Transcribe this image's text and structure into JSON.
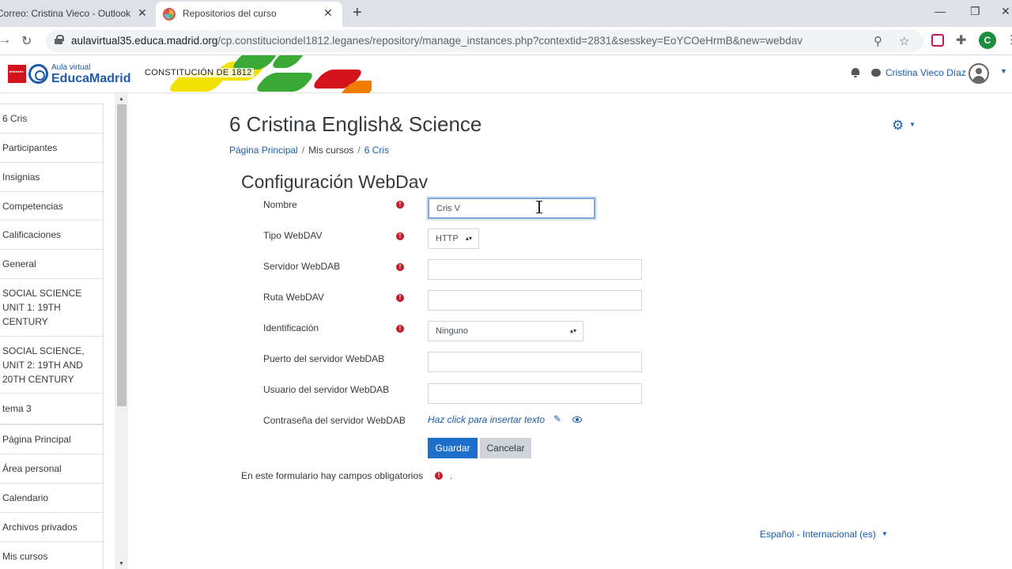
{
  "browser": {
    "tabs": [
      {
        "label": "Correo: Cristina Vieco - Outlook"
      },
      {
        "label": "Repositorios del curso"
      }
    ],
    "url_host": "aulavirtual35.educa.madrid.org",
    "url_path": "/cp.constituciondel1812.leganes/repository/manage_instances.php?contextid=2831&sesskey=EoYCOeHrmB&new=webdav",
    "profile_initial": "C"
  },
  "navbar": {
    "logo_top": "Aula virtual",
    "logo_main": "EducaMadrid",
    "school_name": "CONSTITUCIÓN DE 1812",
    "user_name": "Cristina Vieco Díaz"
  },
  "sidebar": {
    "items": [
      {
        "label": "6 Cris"
      },
      {
        "label": "Participantes"
      },
      {
        "label": "Insignias"
      },
      {
        "label": "Competencias"
      },
      {
        "label": "Calificaciones"
      },
      {
        "label": "General"
      },
      {
        "label": "SOCIAL SCIENCE UNIT 1: 19TH CENTURY"
      },
      {
        "label": "SOCIAL SCIENCE, UNIT 2: 19TH AND 20TH CENTURY"
      },
      {
        "label": "tema 3"
      },
      {
        "label": "Página Principal"
      },
      {
        "label": "Área personal"
      },
      {
        "label": "Calendario"
      },
      {
        "label": "Archivos privados"
      },
      {
        "label": "Mis cursos"
      }
    ]
  },
  "main": {
    "page_title": "6 Cristina English& Science",
    "breadcrumb": [
      {
        "label": "Página Principal"
      },
      {
        "label": "Mis cursos"
      },
      {
        "label": "6 Cris"
      }
    ],
    "form_title": "Configuración WebDav",
    "fields": {
      "nombre": {
        "label": "Nombre",
        "value": "Cris V"
      },
      "tipo": {
        "label": "Tipo WebDAV",
        "value": "HTTP"
      },
      "servidor": {
        "label": "Servidor WebDAB",
        "value": ""
      },
      "ruta": {
        "label": "Ruta WebDAV",
        "value": ""
      },
      "identificacion": {
        "label": "Identificación",
        "value": "Ninguno"
      },
      "puerto": {
        "label": "Puerto del servidor WebDAB",
        "value": ""
      },
      "usuario": {
        "label": "Usuario del servidor WebDAB",
        "value": ""
      },
      "contrasena": {
        "label": "Contraseña del servidor WebDAB",
        "link": "Haz click para insertar texto"
      }
    },
    "save_label": "Guardar",
    "cancel_label": "Cancelar",
    "required_note": "En este formulario hay campos obligatorios",
    "language": "Español - Internacional (es)"
  },
  "colors": {
    "accent": "#1e5ba8",
    "save_button": "#1e6fcc",
    "required": "#c41e2c"
  }
}
